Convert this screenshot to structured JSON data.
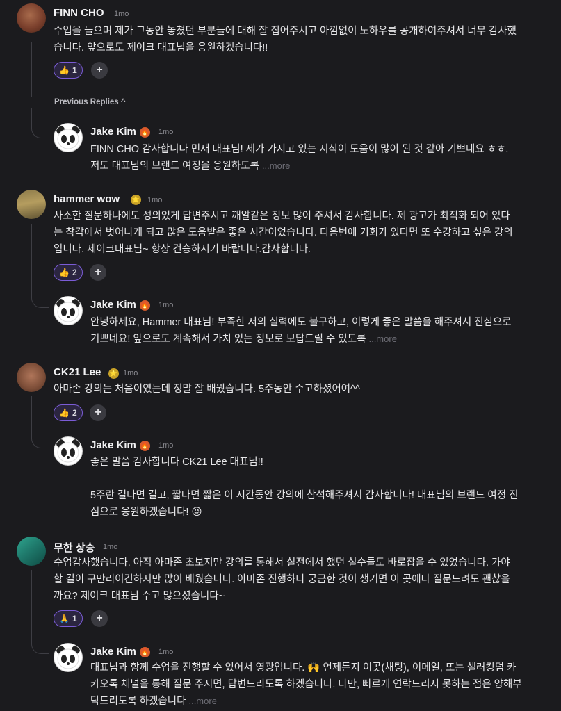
{
  "comments": [
    {
      "author": "FINN CHO",
      "time": "1mo",
      "line1": "수업을 들으며 제가 그동안 놓쳤던 부분들에 대해 잘 집어주시고 아낌없이 노하우를 공개하여주셔서 너무 감사했",
      "line2": "습니다. 앞으로도 제이크 대표님을 응원하겠습니다!!",
      "reaction": {
        "emoji": "👍",
        "count": "1"
      },
      "previous_replies_label": "Previous Replies ^",
      "reply": {
        "author": "Jake Kim",
        "time": "1mo",
        "line1": "FINN CHO 감사합니다 민재 대표님!  제가 가지고 있는 지식이 도움이 많이 된 것 같아 기쁘네요 ㅎㅎ.",
        "line2": "저도 대표님의 브랜드 여정을 응원하도록",
        "more": "...more"
      }
    },
    {
      "author": "hammer wow",
      "time": "1mo",
      "line1": "사소한 질문하나에도 성의있게 답변주시고 깨알같은 정보 많이 주셔서 감사합니다. 제 광고가 최적화 되어 있다",
      "line2": "는 착각에서 벗어나게 되고 많은 도움받은 좋은 시간이었습니다. 다음번에 기회가 있다면 또 수강하고 싶은 강의",
      "line3": "입니다. 제이크대표님~ 항상 건승하시기 바랍니다.감사합니다.",
      "reaction": {
        "emoji": "👍",
        "count": "2"
      },
      "reply": {
        "author": "Jake Kim",
        "time": "1mo",
        "line1": "안녕하세요, Hammer 대표님! 부족한 저의 실력에도 불구하고, 이렇게 좋은 말씀을 해주셔서 진심으로",
        "line2": "기쁘네요! 앞으로도 계속해서 가치 있는 정보로 보답드릴 수 있도록",
        "more": "...more"
      }
    },
    {
      "author": "CK21 Lee",
      "time": "1mo",
      "line1": "아마존 강의는 처음이였는데 정말 잘 배웠습니다. 5주동안 수고하셨어여^^",
      "reaction": {
        "emoji": "👍",
        "count": "2"
      },
      "reply": {
        "author": "Jake Kim",
        "time": "1mo",
        "line1": "좋은 말씀 감사합니다 CK21 Lee 대표님!!",
        "line2": "5주란 길다면 길고, 짧다면 짧은 이 시간동안 강의에 참석해주셔서 감사합니다! 대표님의 브랜드 여정 진",
        "line3": "심으로 응원하겠습니다! 😜"
      }
    },
    {
      "author": "무한 상승",
      "time": "1mo",
      "line1": "수업감사했습니다. 아직 아마존 초보지만 강의를 통해서 실전에서 했던 실수들도 바로잡을 수 있었습니다. 가야",
      "line2": "할 길이 구만리이긴하지만 많이 배웠습니다. 아마존 진행하다 궁금한 것이 생기면 이 곳에다 질문드려도 괜찮을",
      "line3": "까요? 제이크 대표님 수고 많으셨습니다~",
      "reaction": {
        "emoji": "🙏",
        "count": "1"
      },
      "reply": {
        "author": "Jake Kim",
        "time": "1mo",
        "line1": "대표님과 함께 수업을 진행할 수 있어서 영광입니다. 🙌 언제든지 이곳(채팅), 이메일, 또는 셀러킹덤 카",
        "line2": "카오톡 채널을 통해 질문 주시면, 답변드리도록 하겠습니다. 다만, 빠르게 연락드리지 못하는 점은 양해부",
        "line3": "탁드리도록 하겠습니다",
        "more": "...more"
      }
    }
  ],
  "add_reaction_symbol": "+",
  "badges": {
    "fire": "🔥",
    "star": "⭐"
  }
}
